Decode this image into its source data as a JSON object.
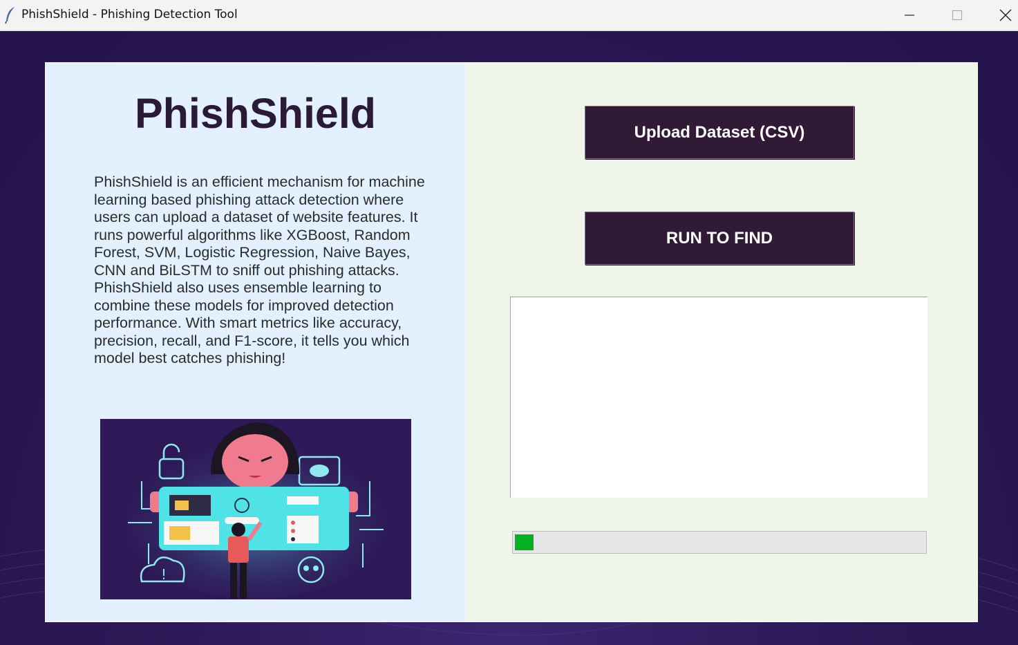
{
  "window": {
    "title": "PhishShield - Phishing Detection Tool",
    "controls": [
      "minimize-icon",
      "maximize-icon",
      "close-icon"
    ]
  },
  "left_panel": {
    "heading": "PhishShield",
    "description": "PhishShield is an efficient mechanism for machine learning based phishing attack detection where users can upload a dataset of website features. It runs powerful algorithms like XGBoost, Random Forest, SVM, Logistic Regression, Naive Bayes, CNN and BiLSTM to sniff out phishing attacks. PhishShield also uses ensemble learning to combine these models for improved detection performance. With smart metrics like accuracy, precision, recall, and F1-score, it tells you which model best catches phishing!"
  },
  "right_panel": {
    "upload_button": "Upload Dataset (CSV)",
    "run_button": "RUN TO FIND",
    "output_text": "",
    "progress_percent": 4.5
  },
  "colors": {
    "background": "#2d1a55",
    "button": "#311a35",
    "left_panel": "#e3f0fd",
    "right_panel": "#f0f5e9",
    "progress": "#06b025"
  }
}
